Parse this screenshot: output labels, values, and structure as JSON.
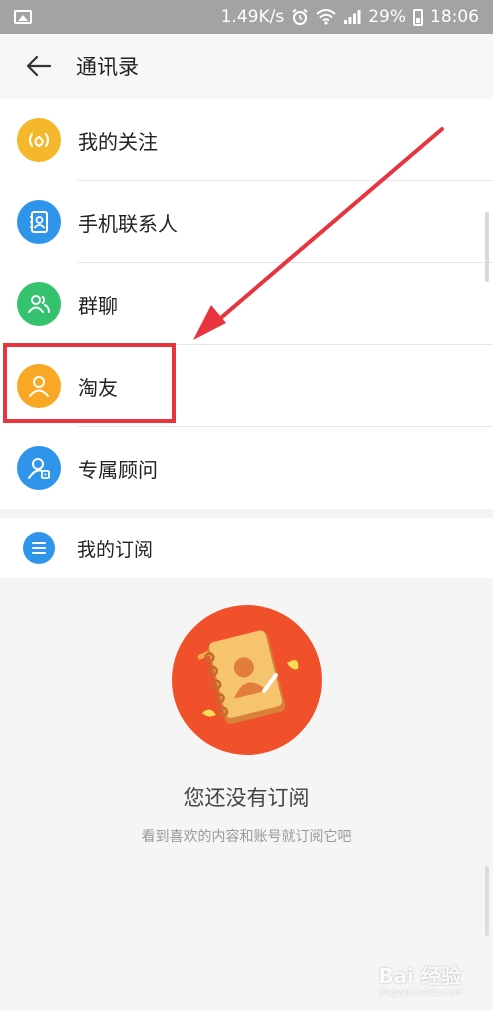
{
  "status_bar": {
    "speed": "1.49K/s",
    "battery": "29%",
    "time": "18:06"
  },
  "header": {
    "title": "通讯录",
    "back_icon": "back-arrow-icon"
  },
  "contacts": [
    {
      "label": "我的关注",
      "icon": "broadcast-heart-icon",
      "color": "#f5b72b"
    },
    {
      "label": "手机联系人",
      "icon": "contact-book-icon",
      "color": "#2f95ea"
    },
    {
      "label": "群聊",
      "icon": "group-icon",
      "color": "#34c26f"
    },
    {
      "label": "淘友",
      "icon": "person-icon",
      "color": "#f9a825"
    },
    {
      "label": "专属顾问",
      "icon": "advisor-icon",
      "color": "#2f95ea"
    }
  ],
  "subscriptions": {
    "label": "我的订阅",
    "icon": "list-icon",
    "color": "#2f95ea"
  },
  "empty_state": {
    "title": "您还没有订阅",
    "description": "看到喜欢的内容和账号就订阅它吧"
  },
  "watermark": {
    "text": "Bai 经验",
    "sub": "jingyan.baidu.com"
  },
  "accent_color": "#e8343d"
}
